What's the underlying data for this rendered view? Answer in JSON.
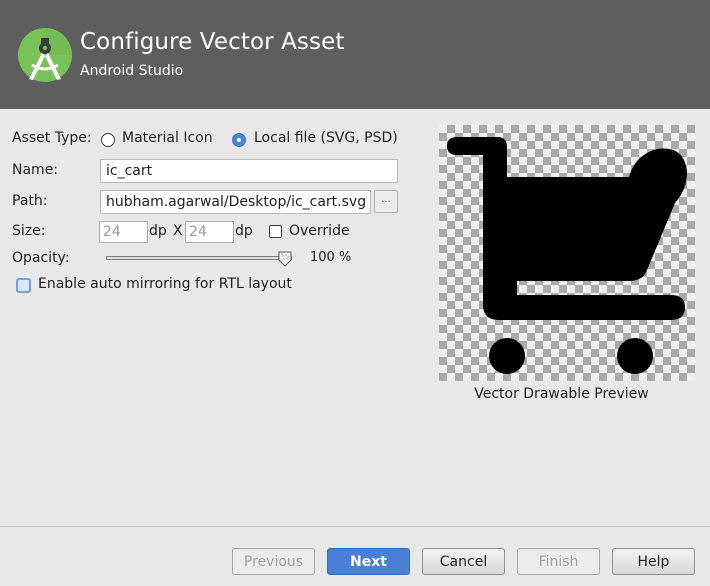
{
  "header": {
    "title": "Configure Vector Asset",
    "subtitle": "Android Studio",
    "logo_icon": "android-studio-logo"
  },
  "form": {
    "asset_type": {
      "label": "Asset Type:",
      "options": [
        {
          "label": "Material Icon",
          "selected": false
        },
        {
          "label": "Local file (SVG, PSD)",
          "selected": true
        }
      ]
    },
    "name": {
      "label": "Name:",
      "value": "ic_cart"
    },
    "path": {
      "label": "Path:",
      "value": "hubham.agarwal/Desktop/ic_cart.svg",
      "browse_label": "..."
    },
    "size": {
      "label": "Size:",
      "width": "24",
      "height": "24",
      "unit": "dp",
      "separator": "X",
      "override_label": "Override",
      "override_checked": false
    },
    "opacity": {
      "label": "Opacity:",
      "value_percent": 100,
      "display": "100 %"
    },
    "auto_mirror": {
      "label": "Enable auto mirroring for RTL layout",
      "checked": false
    }
  },
  "preview": {
    "caption": "Vector Drawable Preview",
    "icon": "shopping-cart-icon"
  },
  "buttons": {
    "previous": "Previous",
    "next": "Next",
    "cancel": "Cancel",
    "finish": "Finish",
    "help": "Help"
  },
  "colors": {
    "header_bg": "#5e5e5e",
    "accent": "#4a7fd6",
    "logo_green": "#78c257"
  }
}
